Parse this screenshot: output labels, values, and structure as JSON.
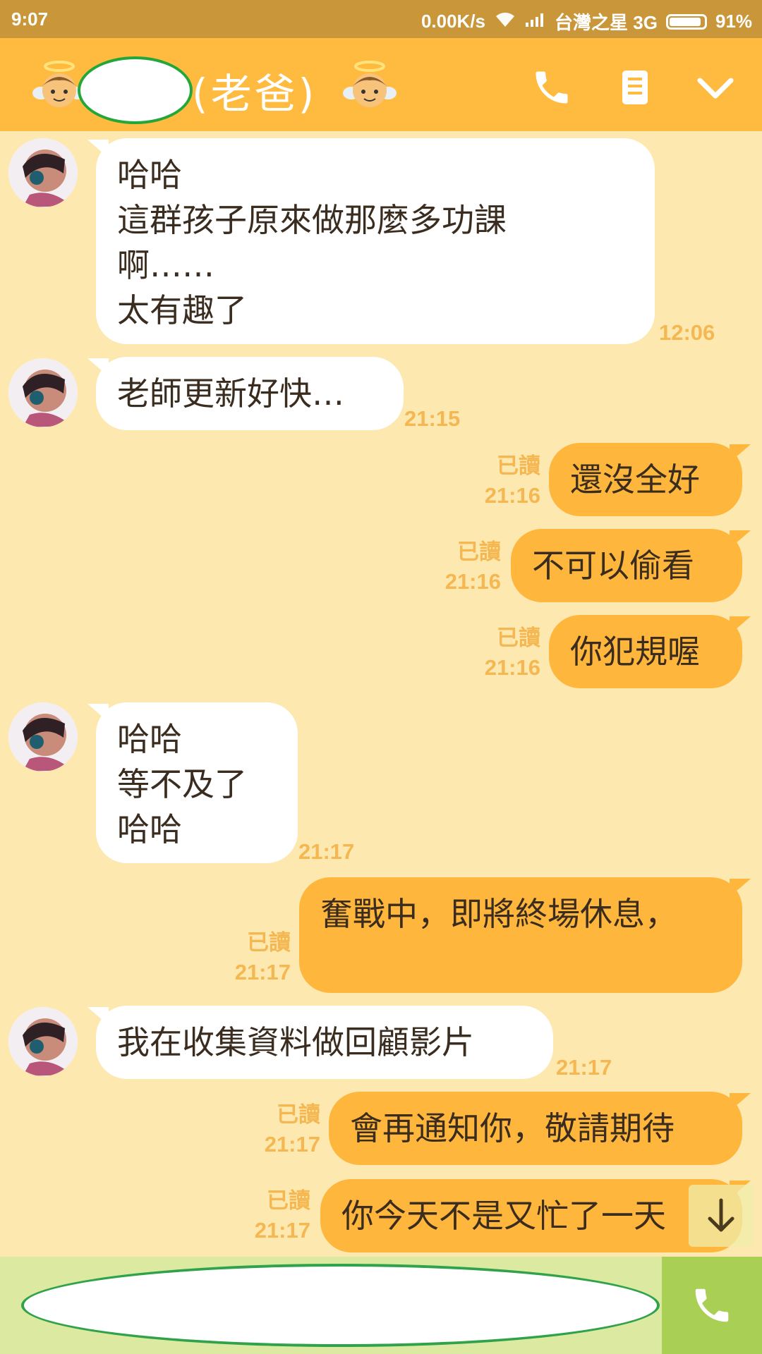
{
  "status_bar": {
    "time": "9:07",
    "network_speed": "0.00K/s",
    "carrier": "台灣之星 3G",
    "battery": "91%",
    "battery_level": 0.91,
    "icons": [
      "wifi-icon",
      "signal-icon",
      "battery-icon"
    ]
  },
  "header": {
    "contact_name": "(老爸)",
    "left_emoji": "angel-emoji-icon",
    "right_emoji": "angel-emoji-icon",
    "actions": [
      "phone-icon",
      "notes-icon",
      "chevron-down-icon"
    ],
    "bg_color": "#FFBB3F"
  },
  "messages": [
    {
      "dir": "in",
      "text": "哈哈\n這群孩子原來做那麼多功課\n啊……\n太有趣了",
      "time": "12:06"
    },
    {
      "dir": "in",
      "text": "老師更新好快…",
      "time": "21:15"
    },
    {
      "dir": "out",
      "text": "還沒全好",
      "read": "已讀",
      "time": "21:16"
    },
    {
      "dir": "out",
      "text": "不可以偷看",
      "read": "已讀",
      "time": "21:16"
    },
    {
      "dir": "out",
      "text": "你犯規喔",
      "read": "已讀",
      "time": "21:16"
    },
    {
      "dir": "in",
      "text": "哈哈\n等不及了\n哈哈",
      "time": "21:17"
    },
    {
      "dir": "out",
      "text": "奮戰中，即將終場休息，",
      "read": "已讀",
      "time": "21:17"
    },
    {
      "dir": "in",
      "text": "我在收集資料做回顧影片",
      "time": "21:17"
    },
    {
      "dir": "out",
      "text": "會再通知你，敬請期待",
      "read": "已讀",
      "time": "21:17"
    },
    {
      "dir": "out",
      "text": "你今天不是又忙了一天",
      "read": "已讀",
      "time": "21:17"
    }
  ],
  "scroll_button": {
    "icon": "arrow-down-icon"
  },
  "input_bar": {
    "placeholder": "",
    "call_icon": "phone-icon"
  },
  "colors": {
    "chat_bg": "#FDE9B0",
    "outgoing_bubble": "#FFB63D",
    "incoming_bubble": "#FFFFFF",
    "timestamp": "#F5B752"
  }
}
